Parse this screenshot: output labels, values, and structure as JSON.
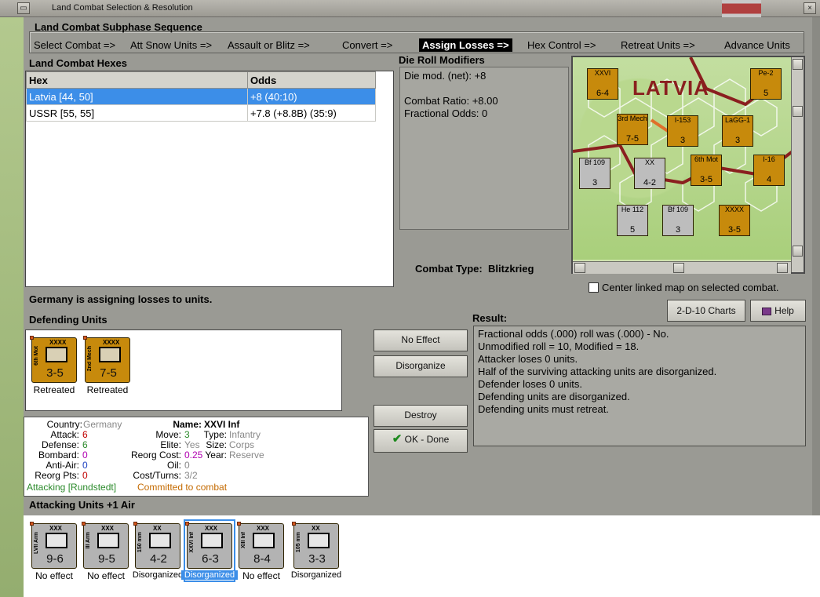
{
  "window": {
    "title": "Land Combat Selection & Resolution"
  },
  "subphase": {
    "header": "Land Combat Subphase Sequence",
    "phases": [
      {
        "label": "Select Combat =>",
        "active": false
      },
      {
        "label": "Att Snow Units =>",
        "active": false
      },
      {
        "label": "Assault or Blitz =>",
        "active": false
      },
      {
        "label": "Convert =>",
        "active": false
      },
      {
        "label": "Assign Losses =>",
        "active": true
      },
      {
        "label": "Hex Control =>",
        "active": false
      },
      {
        "label": "Retreat Units =>",
        "active": false
      },
      {
        "label": "Advance Units",
        "active": false
      }
    ]
  },
  "hexes": {
    "header": "Land Combat Hexes",
    "columns": [
      "Hex",
      "Odds"
    ],
    "rows": [
      {
        "hex": "Latvia [44, 50]",
        "odds": "+8 (40:10)",
        "selected": true
      },
      {
        "hex": "USSR [55, 55]",
        "odds": "+7.8 (+8.8B) (35:9)",
        "selected": false
      }
    ]
  },
  "modifiers": {
    "header": "Die Roll Modifiers",
    "die_mod": "Die mod. (net): +8",
    "combat_ratio": "Combat Ratio: +8.00",
    "fractional": "Fractional Odds: 0"
  },
  "combat_type": {
    "label": "Combat Type:",
    "value": "Blitzkrieg"
  },
  "map": {
    "region": "LATVIA",
    "center_checkbox": "Center linked map on selected combat.",
    "counters": [
      {
        "name": "6th Mot",
        "str": "3-5"
      },
      {
        "name": "3rd Mech",
        "str": "7-5"
      },
      {
        "name": "XXVI",
        "str": "6-4"
      },
      {
        "name": "LaGG-1",
        "str": "3"
      }
    ]
  },
  "status": "Germany is assigning losses to units.",
  "defending": {
    "header": "Defending Units",
    "units": [
      {
        "name": "6th Mot",
        "size": "XXXX",
        "str": "3-5",
        "status": "Retreated"
      },
      {
        "name": "2nd Mech",
        "size": "XXXX",
        "str": "7-5",
        "status": "Retreated"
      }
    ]
  },
  "buttons": {
    "no_effect": "No Effect",
    "disorganize": "Disorganize",
    "destroy": "Destroy",
    "ok_done": "OK - Done",
    "charts": "2-D-10 Charts",
    "help": "Help"
  },
  "result": {
    "header": "Result:",
    "lines": [
      "Fractional odds (.000) roll was (.000)  - No.",
      "Unmodified roll = 10, Modified = 18.",
      "Attacker loses 0 units.",
      "Half of the surviving attacking units are disorganized.",
      "Defender loses 0 units.",
      "Defending units are disorganized.",
      "Defending units must retreat."
    ]
  },
  "unit_info": {
    "country_label": "Country:",
    "country": "Germany",
    "name_label": "Name:",
    "name": "XXVI Inf",
    "attack_label": "Attack:",
    "attack": "6",
    "move_label": "Move:",
    "move": "3",
    "type_label": "Type:",
    "type": "Infantry",
    "defense_label": "Defense:",
    "defense": "6",
    "elite_label": "Elite:",
    "elite": "Yes",
    "size_label": "Size:",
    "size": "Corps",
    "bombard_label": "Bombard:",
    "bombard": "0",
    "reorg_cost_label": "Reorg Cost:",
    "reorg_cost": "0.25",
    "year_label": "Year:",
    "year": "Reserve",
    "antiair_label": "Anti-Air:",
    "antiair": "0",
    "oil_label": "Oil:",
    "oil": "0",
    "reorg_pts_label": "Reorg Pts:",
    "reorg_pts": "0",
    "cost_turns_label": "Cost/Turns:",
    "cost_turns": "3/2",
    "attacking": "Attacking [Rundstedt]",
    "committed": "Committed to combat"
  },
  "attacking": {
    "header": "Attacking Units +1 Air",
    "units": [
      {
        "name": "LVII Arm",
        "size": "XXX",
        "str": "9-6",
        "status": "No effect",
        "color": "gray",
        "selected": false
      },
      {
        "name": "III Arm",
        "size": "XXX",
        "str": "9-5",
        "status": "No effect",
        "color": "gray",
        "selected": false
      },
      {
        "name": "150 mm",
        "size": "XX",
        "str": "4-2",
        "status": "Disorganized",
        "color": "gray",
        "selected": false
      },
      {
        "name": "XXVI Inf",
        "size": "XXX",
        "str": "6-3",
        "status": "Disorganized",
        "color": "gray",
        "selected": true
      },
      {
        "name": "XIII Inf",
        "size": "XXX",
        "str": "8-4",
        "status": "No effect",
        "color": "gray",
        "selected": false
      },
      {
        "name": "105 mm",
        "size": "XX",
        "str": "3-3",
        "status": "Disorganized",
        "color": "gray",
        "selected": false
      }
    ]
  },
  "colors": {
    "highlight": "#3c8ee8",
    "counter_orange": "#c78a0c",
    "counter_gray": "#b3b3b3",
    "info_red": "#c00000",
    "info_green": "#2b8a2b",
    "info_orange": "#c46a00"
  }
}
